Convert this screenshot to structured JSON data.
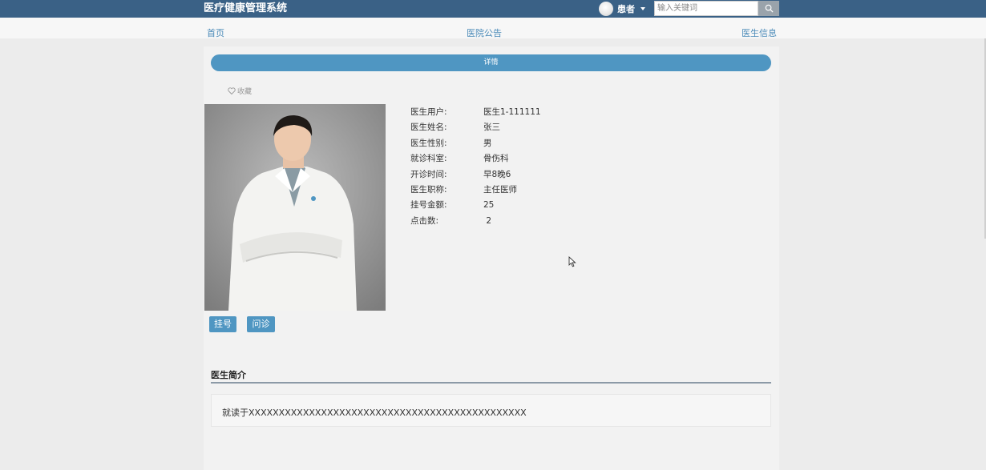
{
  "app": {
    "title": "医疗健康管理系统"
  },
  "header": {
    "user_role": "患者",
    "search": {
      "placeholder": "输入关键词",
      "value": ""
    }
  },
  "nav": {
    "items": [
      {
        "label": "首页"
      },
      {
        "label": "医院公告"
      },
      {
        "label": "医生信息"
      }
    ]
  },
  "detail": {
    "bar_label": "详情",
    "favorite_label": "收藏",
    "fields": [
      {
        "label": "医生用户:",
        "value": "医生1-111111"
      },
      {
        "label": "医生姓名:",
        "value": "张三"
      },
      {
        "label": "医生性别:",
        "value": "男"
      },
      {
        "label": "就诊科室:",
        "value": "骨伤科"
      },
      {
        "label": "开诊时间:",
        "value": "早8晚6"
      },
      {
        "label": "医生职称:",
        "value": "主任医师"
      },
      {
        "label": "挂号金额:",
        "value": "25"
      },
      {
        "label": "点击数:",
        "value": " 2"
      }
    ],
    "buttons": {
      "register": "挂号",
      "consult": "问诊"
    },
    "intro": {
      "title": "医生简介",
      "text": "就读于XXXXXXXXXXXXXXXXXXXXXXXXXXXXXXXXXXXXXXXXXXXXXX"
    }
  },
  "colors": {
    "header_bg": "#3a6186",
    "accent": "#4f96c2",
    "link": "#4a8ab8"
  },
  "icons": {
    "search": "search-icon",
    "favorite": "heart-outline-icon",
    "dropdown": "caret-down-icon"
  }
}
